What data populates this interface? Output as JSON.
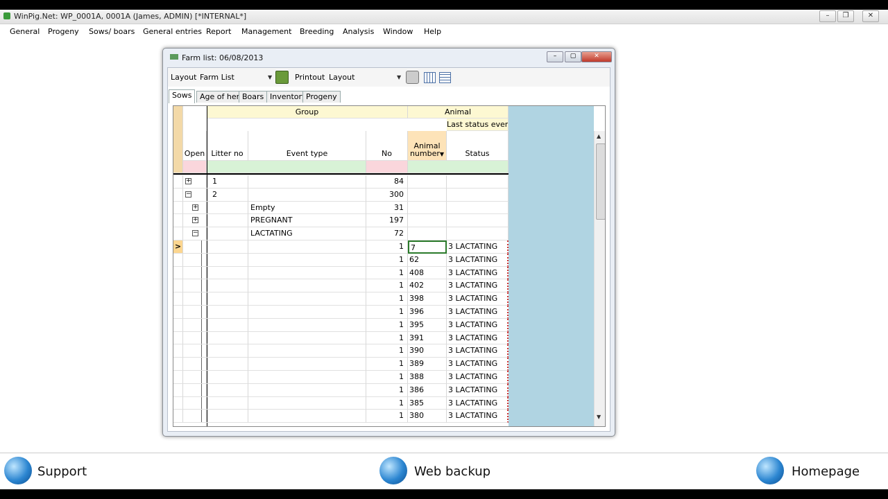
{
  "app": {
    "title": "WinPig.Net: WP_0001A, 0001A (James, ADMIN)  [*INTERNAL*]"
  },
  "menu": [
    "General",
    "Progeny",
    "Sows/ boars",
    "General entries",
    "Report",
    "Management",
    "Breeding",
    "Analysis",
    "Window",
    "Help"
  ],
  "window": {
    "title": "Farm list: 06/08/2013",
    "toolbar": {
      "layout_label": "Layout",
      "layout_value": "Farm List",
      "printout_label": "Printout",
      "printout_value": "Layout"
    },
    "tabs": [
      "Sows",
      "Age of herd",
      "Boars",
      "Inventory",
      "Progeny"
    ],
    "active_tab": "Sows",
    "grid": {
      "group_header": "Group",
      "animal_header": "Animal",
      "last_status_header": "Last status event",
      "columns": {
        "open": "Open",
        "litter_no": "Litter no",
        "event_type": "Event type",
        "no": "No",
        "animal_number": "Animal number",
        "status": "Status"
      },
      "group_rows": [
        {
          "litter": "1",
          "event": "",
          "no": "84"
        },
        {
          "litter": "2",
          "event": "",
          "no": "300"
        },
        {
          "litter": "",
          "event": "Empty",
          "no": "31"
        },
        {
          "litter": "",
          "event": "PREGNANT",
          "no": "197"
        },
        {
          "litter": "",
          "event": "LACTATING",
          "no": "72"
        }
      ],
      "animal_rows": [
        {
          "no": "1",
          "animal": "7",
          "status": "3 LACTATING"
        },
        {
          "no": "1",
          "animal": "62",
          "status": "3 LACTATING"
        },
        {
          "no": "1",
          "animal": "408",
          "status": "3 LACTATING"
        },
        {
          "no": "1",
          "animal": "402",
          "status": "3 LACTATING"
        },
        {
          "no": "1",
          "animal": "398",
          "status": "3 LACTATING"
        },
        {
          "no": "1",
          "animal": "396",
          "status": "3 LACTATING"
        },
        {
          "no": "1",
          "animal": "395",
          "status": "3 LACTATING"
        },
        {
          "no": "1",
          "animal": "391",
          "status": "3 LACTATING"
        },
        {
          "no": "1",
          "animal": "390",
          "status": "3 LACTATING"
        },
        {
          "no": "1",
          "animal": "389",
          "status": "3 LACTATING"
        },
        {
          "no": "1",
          "animal": "388",
          "status": "3 LACTATING"
        },
        {
          "no": "1",
          "animal": "386",
          "status": "3 LACTATING"
        },
        {
          "no": "1",
          "animal": "385",
          "status": "3 LACTATING"
        },
        {
          "no": "1",
          "animal": "380",
          "status": "3 LACTATING"
        }
      ],
      "current_row_marker": ">"
    }
  },
  "bottom": {
    "support": "Support",
    "web_backup": "Web backup",
    "homepage": "Homepage"
  },
  "colors": {
    "grid_blue": "#b0d4e2",
    "header_yellow": "#fdf8d2",
    "header_orange": "#fde3b8"
  }
}
